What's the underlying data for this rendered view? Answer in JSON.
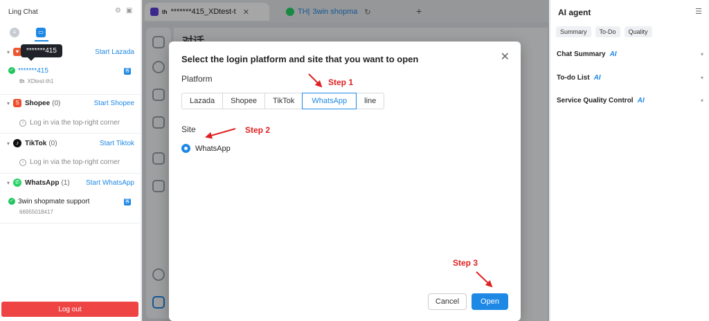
{
  "left": {
    "title": "Ling Chat",
    "tooltip": "*******415",
    "platforms": [
      {
        "name": "",
        "count": "",
        "start": "Start Lazada"
      },
      {
        "name": "Shopee",
        "count": "(0)",
        "start": "Start Shopee",
        "empty": "Log in via the top-right corner"
      },
      {
        "name": "TikTok",
        "count": "(0)",
        "start": "Start Tiktok",
        "empty": "Log in via the top-right corner"
      },
      {
        "name": "WhatsApp",
        "count": "(1)",
        "start": "Start WhatsApp"
      }
    ],
    "lazada_account": {
      "name": "*******415",
      "sub_prefix": "th",
      "sub": "XDtest-th1"
    },
    "whatsapp_account": {
      "name": "3win shopmate support",
      "sub": "66955018417"
    },
    "logout": "Log out"
  },
  "browser": {
    "tabs": [
      {
        "prefix": "th",
        "label": "*******415_XDtest-t"
      },
      {
        "prefix": "TH|",
        "label": "3win shopma"
      }
    ],
    "bg_title": "对话"
  },
  "dialog": {
    "title": "Select the login platform and site that you want to open",
    "platform_label": "Platform",
    "platforms": [
      "Lazada",
      "Shopee",
      "TikTok",
      "WhatsApp",
      "line"
    ],
    "selected_platform": "WhatsApp",
    "site_label": "Site",
    "site_option": "WhatsApp",
    "cancel": "Cancel",
    "open": "Open",
    "step1": "Step 1",
    "step2": "Step 2",
    "step3": "Step 3"
  },
  "right": {
    "title": "AI agent",
    "chips": [
      "Summary",
      "To-Do",
      "Quality"
    ],
    "sections": [
      "Chat Summary",
      "To-do List",
      "Service Quality Control"
    ],
    "ai_tag": "AI"
  },
  "colors": {
    "accent": "#1e88e5",
    "danger": "#ef4444",
    "annotation": "#e02020"
  }
}
